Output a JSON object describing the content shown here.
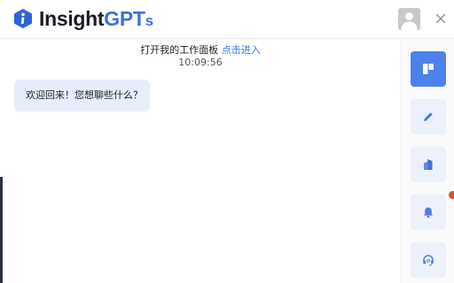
{
  "header": {
    "brand_part1": "Insight",
    "brand_part2": "GPT",
    "brand_part3": "s",
    "brand_color": "#3d6fe0"
  },
  "chat": {
    "notice_text": "打开我的工作面板",
    "notice_link": "点击进入",
    "timestamp": "10:09:56",
    "welcome_message": "欢迎回来！您想聊些什么？"
  },
  "sidebar": {
    "items": [
      {
        "icon": "board-icon",
        "active": true
      },
      {
        "icon": "pen-icon",
        "active": false
      },
      {
        "icon": "building-icon",
        "active": false
      },
      {
        "icon": "bell-icon",
        "active": false,
        "has_notification": true
      },
      {
        "icon": "headset-icon",
        "active": false
      }
    ],
    "accent_color": "#4c82ec",
    "notification_color": "#e0512f"
  }
}
